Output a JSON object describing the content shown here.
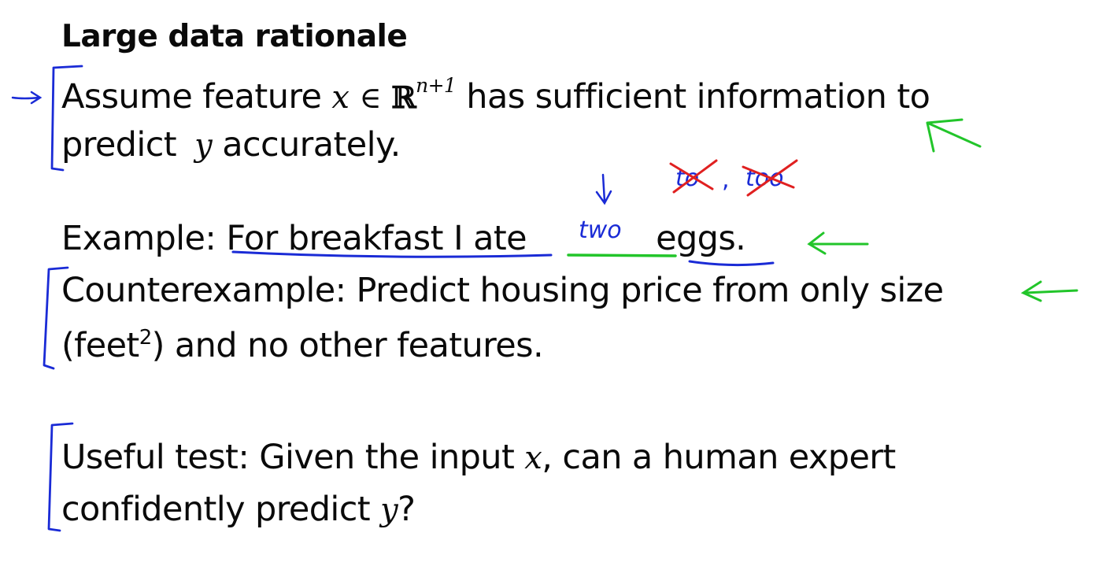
{
  "slide": {
    "title": "Large data rationale",
    "assume": {
      "prefix": "Assume feature",
      "var_x": "x",
      "in_sym": "∈",
      "reals": "ℝ",
      "exponent": "n+1",
      "suffix": "has sufficient information to",
      "line2_prefix": "predict",
      "var_y": "y",
      "line2_suffix": "accurately."
    },
    "example": {
      "label": "Example:",
      "sentence_start": "For breakfast I ate",
      "sentence_end": "eggs."
    },
    "counterexample": {
      "line1": "Counterexample: Predict housing price from only size",
      "line2_prefix": "(feet",
      "line2_exp": "2",
      "line2_suffix": ") and no other features."
    },
    "useful_test": {
      "line1_prefix": "Useful test: Given the input",
      "var_x": "x",
      "line1_suffix": ", can a human expert",
      "line2_prefix": "confidently predict",
      "var_y": "y",
      "line2_suffix": "?"
    }
  },
  "annotations": {
    "blank_fill": "two",
    "struck_words": [
      "to",
      "too"
    ],
    "comma": ",",
    "colors": {
      "blue_ink": "#1a2bd6",
      "green_ink": "#22c52a",
      "red_ink": "#e02020"
    }
  }
}
